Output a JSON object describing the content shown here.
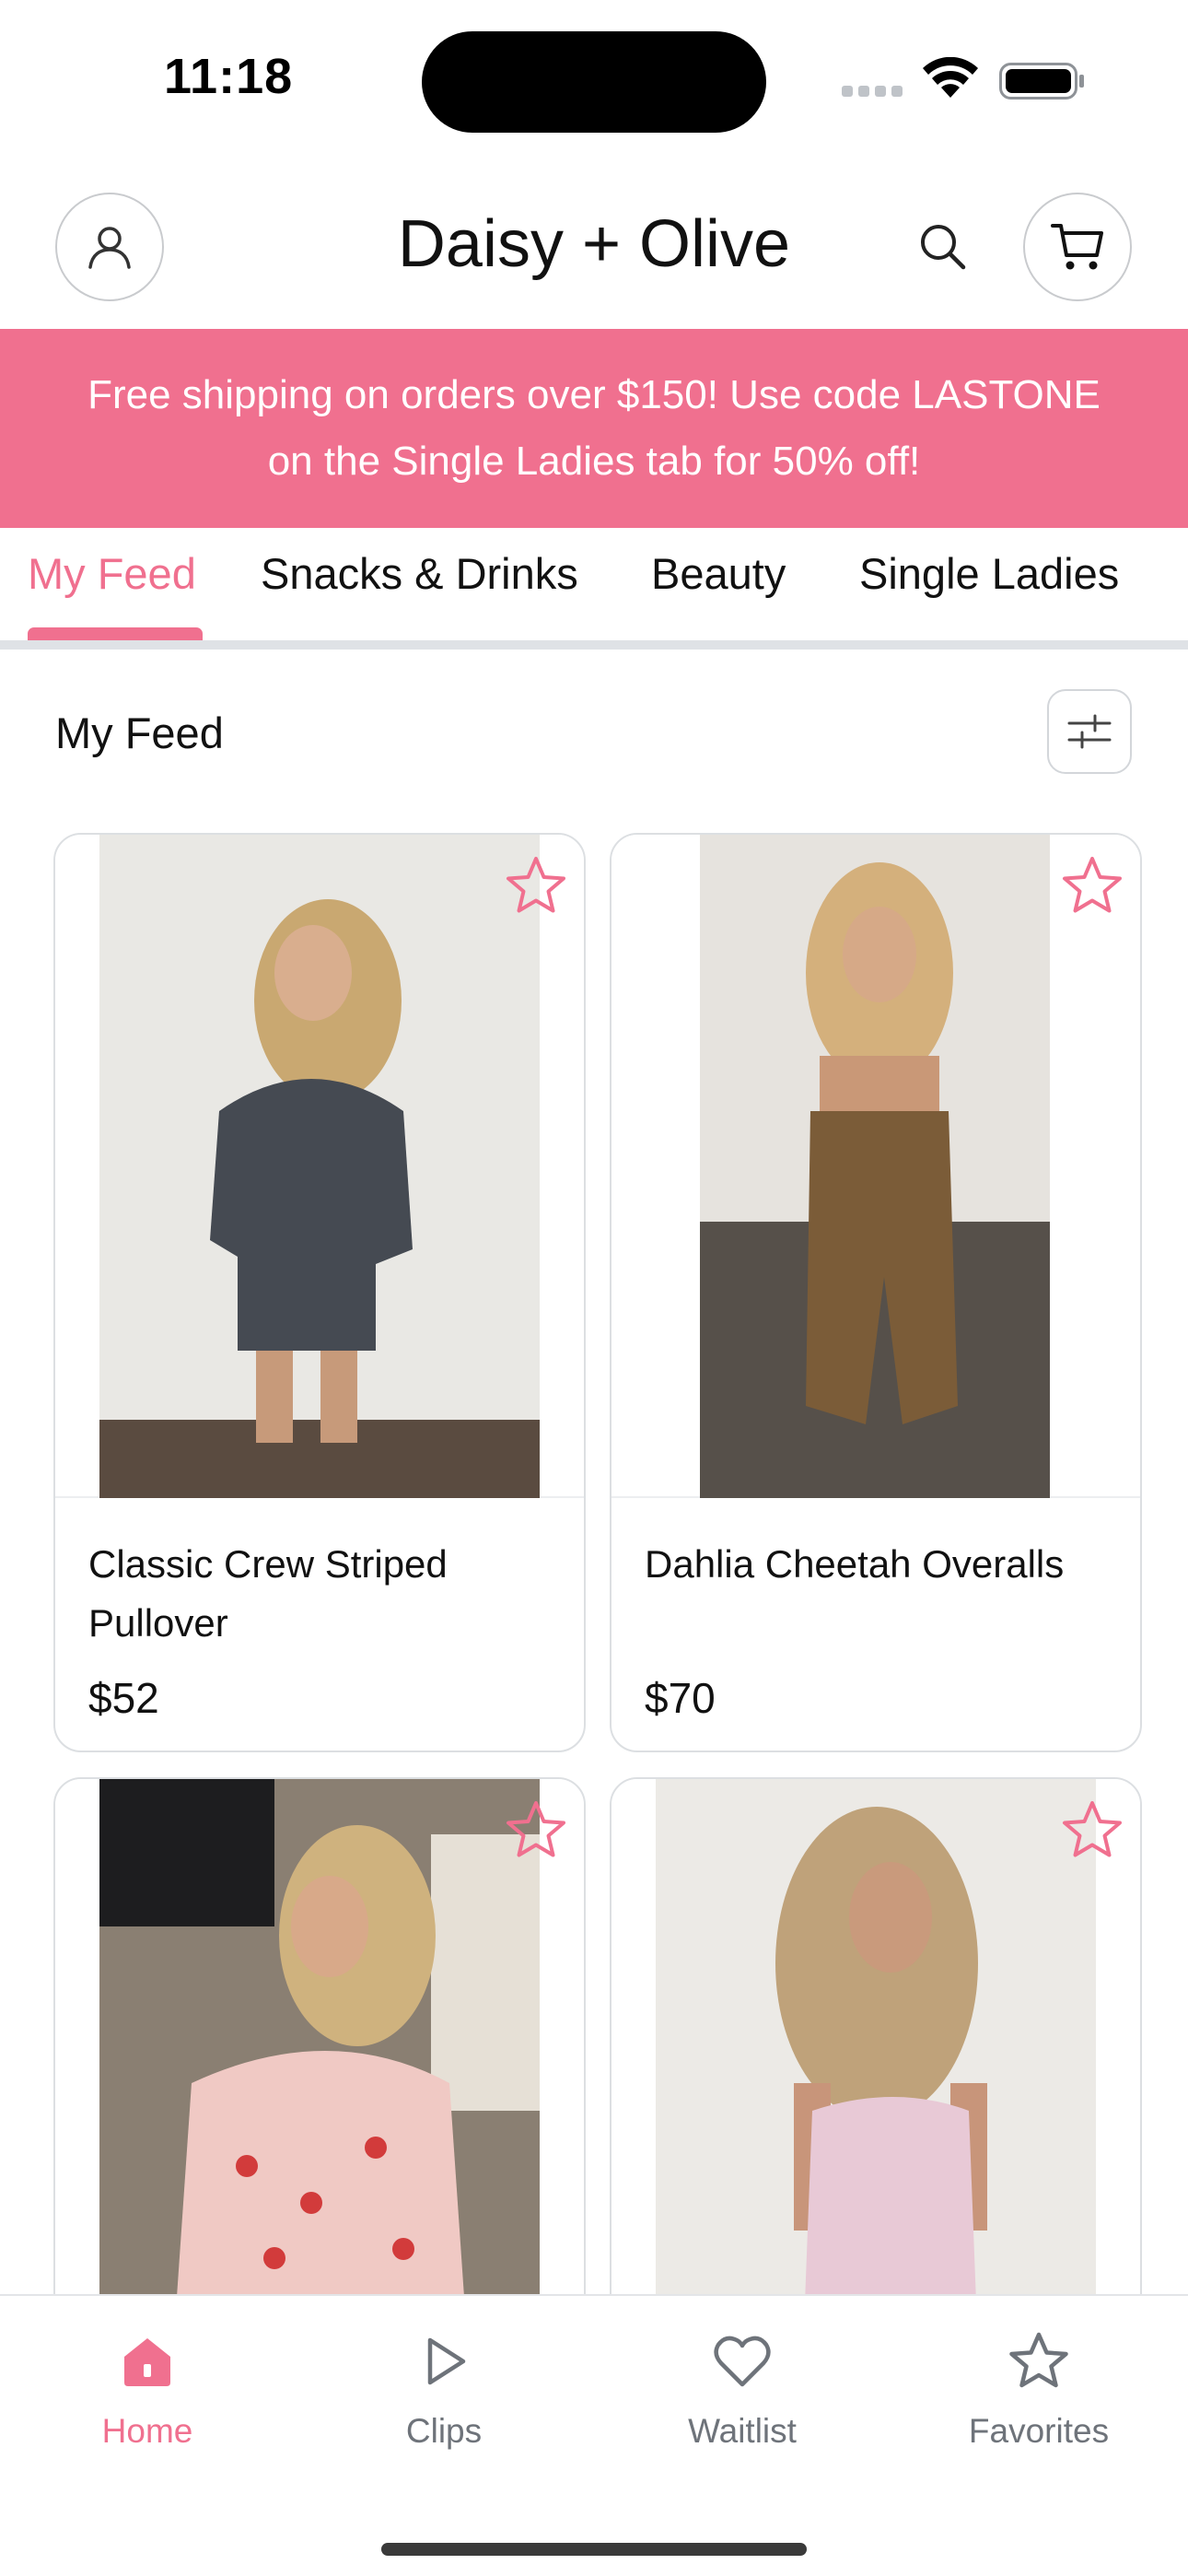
{
  "status_bar": {
    "time": "11:18"
  },
  "header": {
    "brand": "Daisy + Olive",
    "profile_icon": "person-icon",
    "search_icon": "search-icon",
    "cart_icon": "cart-icon"
  },
  "banner": {
    "line1": "Free shipping on orders over $150! Use code LASTONE",
    "line2": "on the Single Ladies tab for 50% off!"
  },
  "tabs": [
    {
      "label": "My Feed",
      "active": true
    },
    {
      "label": "Snacks & Drinks",
      "active": false
    },
    {
      "label": "Beauty",
      "active": false
    },
    {
      "label": "Single Ladies",
      "active": false
    }
  ],
  "section": {
    "title": "My Feed",
    "filter_icon": "sliders-icon"
  },
  "products": [
    {
      "name": "Classic Crew Striped Pullover",
      "price": "$52",
      "favorite_icon": "star-outline-icon"
    },
    {
      "name": "Dahlia Cheetah Overalls",
      "price": "$70",
      "favorite_icon": "star-outline-icon"
    },
    {
      "name": "",
      "price": "",
      "favorite_icon": "star-outline-icon"
    },
    {
      "name": "",
      "price": "",
      "favorite_icon": "star-outline-icon"
    }
  ],
  "bottom_nav": [
    {
      "label": "Home",
      "icon": "home-icon",
      "active": true
    },
    {
      "label": "Clips",
      "icon": "play-icon",
      "active": false
    },
    {
      "label": "Waitlist",
      "icon": "heart-icon",
      "active": false
    },
    {
      "label": "Favorites",
      "icon": "star-icon",
      "active": false
    }
  ],
  "colors": {
    "accent": "#f0708f",
    "text": "#111111",
    "muted": "#6e737a",
    "border": "#dcdfe2"
  }
}
